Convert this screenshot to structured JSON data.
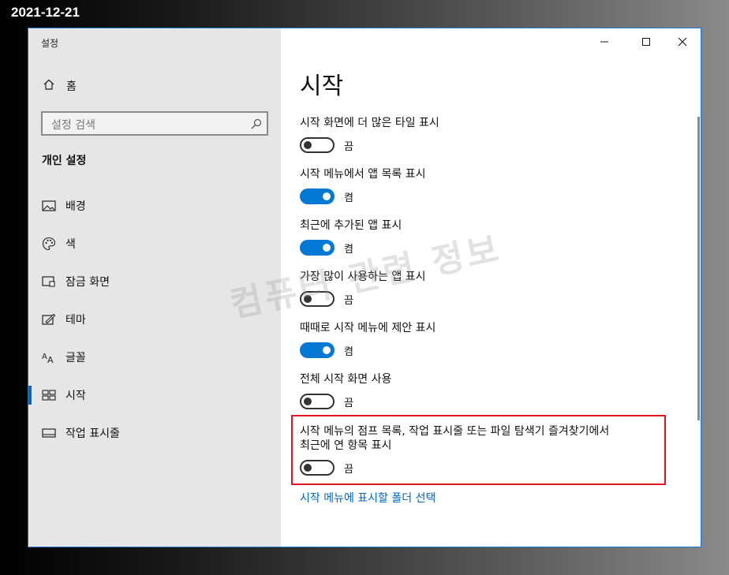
{
  "date_stamp": "2021-12-21",
  "window": {
    "title": "설정"
  },
  "sidebar": {
    "home_label": "홈",
    "search_placeholder": "설정 검색",
    "section_title": "개인 설정",
    "items": [
      {
        "label": "배경",
        "icon": "picture-icon"
      },
      {
        "label": "색",
        "icon": "palette-icon"
      },
      {
        "label": "잠금 화면",
        "icon": "lock-screen-icon"
      },
      {
        "label": "테마",
        "icon": "theme-brush-icon"
      },
      {
        "label": "글꼴",
        "icon": "font-icon",
        "glyph": "A"
      },
      {
        "label": "시작",
        "icon": "start-tiles-icon",
        "active": true
      },
      {
        "label": "작업 표시줄",
        "icon": "taskbar-icon"
      }
    ]
  },
  "content": {
    "page_title": "시작",
    "settings": [
      {
        "label": "시작 화면에 더 많은 타일 표시",
        "state": "끔",
        "on": false
      },
      {
        "label": "시작 메뉴에서 앱 목록 표시",
        "state": "켬",
        "on": true
      },
      {
        "label": "최근에 추가된 앱 표시",
        "state": "켬",
        "on": true
      },
      {
        "label": "가장 많이 사용하는 앱 표시",
        "state": "끔",
        "on": false
      },
      {
        "label": "때때로 시작 메뉴에 제안 표시",
        "state": "켬",
        "on": true
      },
      {
        "label": "전체 시작 화면 사용",
        "state": "끔",
        "on": false
      },
      {
        "label_line1": "시작 메뉴의 점프 목록, 작업 표시줄 또는 파일 탐색기 즐겨찾기에서",
        "label_line2": "최근에 연 항목 표시",
        "state": "끔",
        "on": false
      }
    ],
    "link": "시작 메뉴에 표시할 폴더 선택"
  },
  "watermark": "컴퓨터 관련 정보",
  "colors": {
    "accent": "#0078d4",
    "highlight_border": "#e0141e",
    "sidebar_bg": "#e6e6e6"
  }
}
